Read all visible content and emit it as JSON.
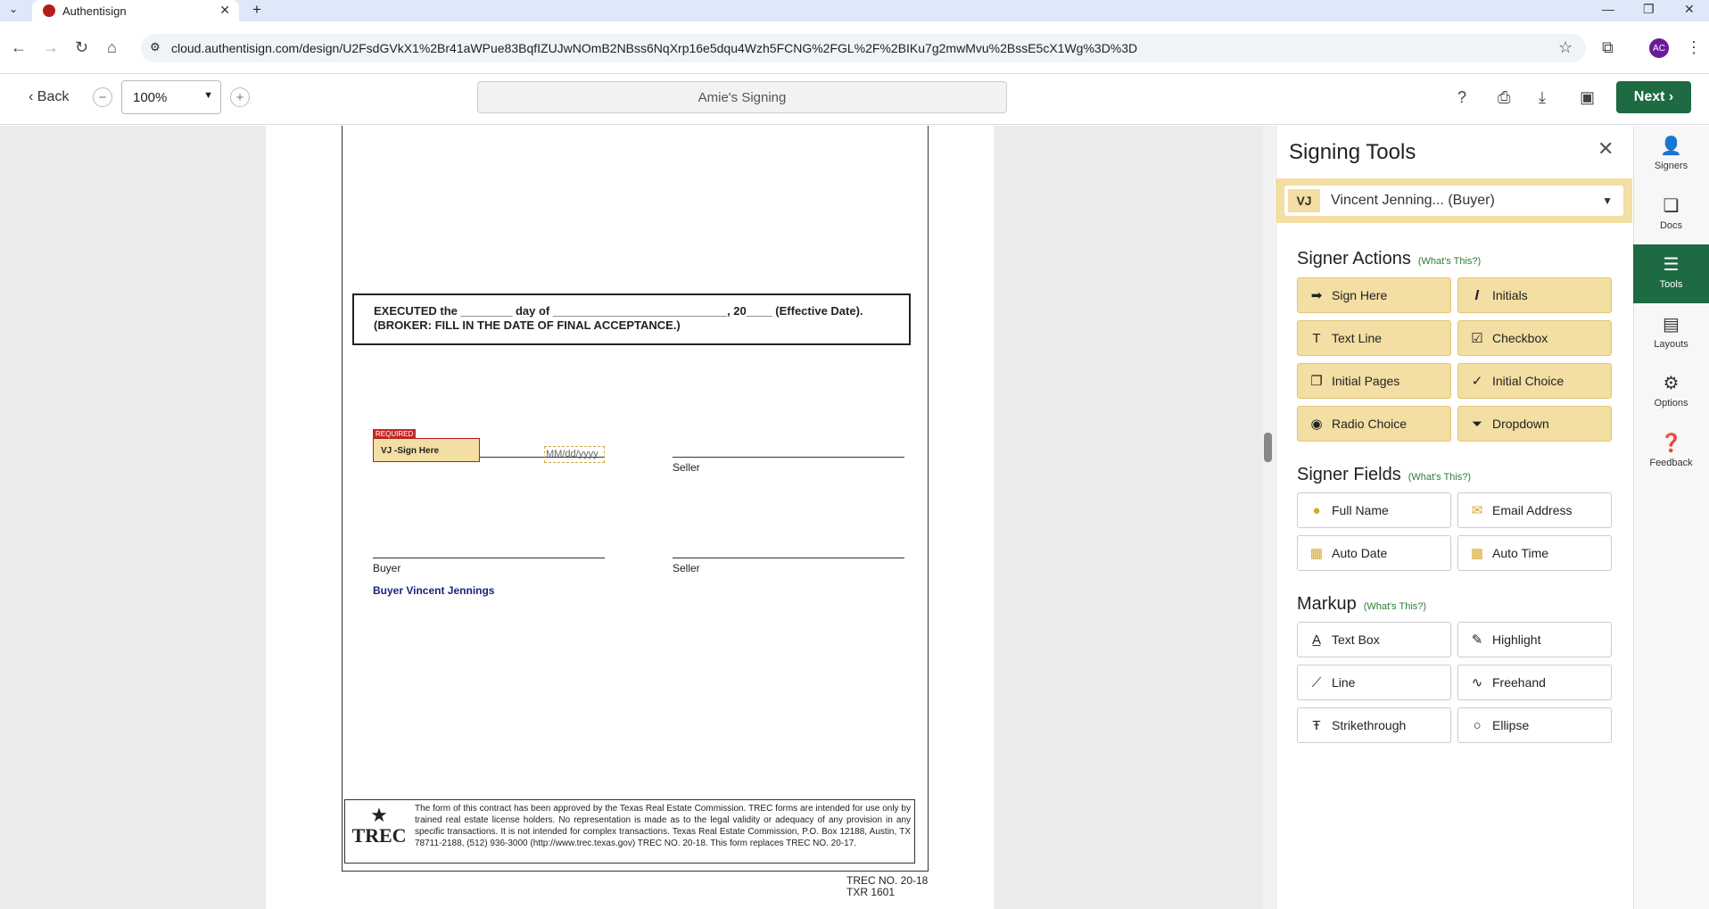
{
  "browser": {
    "tab_title": "Authentisign",
    "url": "cloud.authentisign.com/design/U2FsdGVkX1%2Br41aWPue83BqfIZUJwNOmB2NBss6NqXrp16e5dqu4Wzh5FCNG%2FGL%2F%2BIKu7g2mwMvu%2BssE5cX1Wg%3D%3D",
    "profile_initials": "AC"
  },
  "toolbar": {
    "back_label": "Back",
    "zoom_value": "100%",
    "doc_name": "Amie's Signing",
    "next_label": "Next ›"
  },
  "document": {
    "executed_line1": "EXECUTED the ________ day of ___________________________, 20____ (Effective Date).",
    "executed_line2": "(BROKER: FILL IN THE DATE OF FINAL ACCEPTANCE.)",
    "required_badge": "REQUIRED",
    "sign_here_field": "VJ -Sign Here",
    "buyer_name": "Buyer Vincent  Jennings",
    "date_placeholder": "MM/dd/yyyy",
    "labels": {
      "seller1": "Seller",
      "buyer2": "Buyer",
      "seller2": "Seller"
    },
    "trec_logo": "TREC",
    "trec_text": "The form of this contract has been approved by the Texas Real Estate Commission. TREC forms are intended for use only by trained real estate license holders. No representation is made as to the legal validity or adequacy of any provision in any specific transactions. It is not intended for complex transactions. Texas Real Estate Commission, P.O. Box 12188, Austin, TX 78711-2188, (512) 936-3000 (http://www.trec.texas.gov) TREC NO. 20-18. This form replaces TREC NO. 20-17.",
    "trec_no": "TREC NO. 20-18",
    "txr_no": "TXR 1601"
  },
  "panel": {
    "title": "Signing Tools",
    "signer_initials": "VJ",
    "signer_name": "Vincent Jenning... (Buyer)",
    "whats_this": "(What's This?)",
    "signer_actions_title": "Signer Actions",
    "signer_actions": [
      "Sign Here",
      "Initials",
      "Text Line",
      "Checkbox",
      "Initial Pages",
      "Initial Choice",
      "Radio Choice",
      "Dropdown"
    ],
    "signer_fields_title": "Signer Fields",
    "signer_fields": [
      "Full Name",
      "Email Address",
      "Auto Date",
      "Auto Time"
    ],
    "markup_title": "Markup",
    "markup": [
      "Text Box",
      "Highlight",
      "Line",
      "Freehand",
      "Strikethrough",
      "Ellipse"
    ]
  },
  "rail": [
    "Signers",
    "Docs",
    "Tools",
    "Layouts",
    "Options",
    "Feedback"
  ],
  "colors": {
    "accent": "#1e6b43",
    "signer_yellow": "#f3dea3",
    "required_red": "#c62828"
  }
}
